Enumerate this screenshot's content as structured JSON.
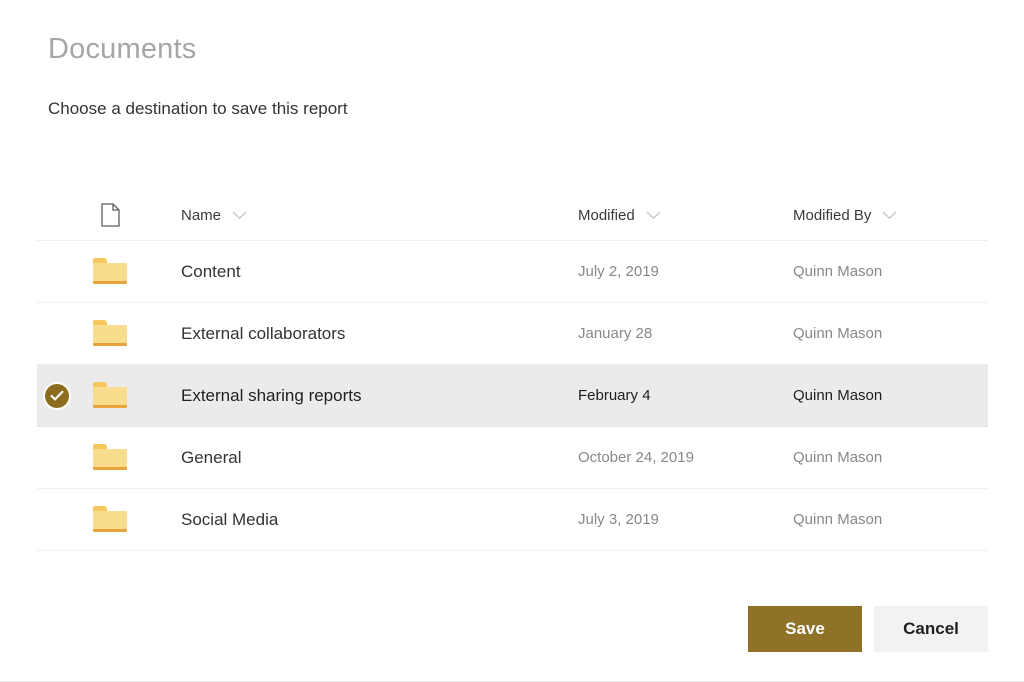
{
  "header": {
    "title": "Documents",
    "subtitle": "Choose a destination to save this report"
  },
  "table": {
    "columns": {
      "file_type_icon": "document-icon",
      "name": "Name",
      "modified": "Modified",
      "modified_by": "Modified By"
    },
    "sort_icon": "chevron-down-icon",
    "rows": [
      {
        "icon": "folder-icon",
        "name": "Content",
        "modified": "July 2, 2019",
        "modified_by": "Quinn Mason",
        "selected": false
      },
      {
        "icon": "folder-icon",
        "name": "External collaborators",
        "modified": "January 28",
        "modified_by": "Quinn Mason",
        "selected": false
      },
      {
        "icon": "folder-icon",
        "name": "External sharing reports",
        "modified": "February 4",
        "modified_by": "Quinn Mason",
        "selected": true
      },
      {
        "icon": "folder-icon",
        "name": "General",
        "modified": "October 24, 2019",
        "modified_by": "Quinn Mason",
        "selected": false
      },
      {
        "icon": "folder-icon",
        "name": "Social Media",
        "modified": "July 3, 2019",
        "modified_by": "Quinn Mason",
        "selected": false
      }
    ]
  },
  "footer": {
    "save_label": "Save",
    "cancel_label": "Cancel"
  },
  "colors": {
    "accent": "#8f7128",
    "selected_row": "#ebebeb",
    "secondary_button": "#f3f2f1",
    "folder_body": "#f9dd8e",
    "folder_lip": "#e8a33d",
    "title_text": "#a6a6a6",
    "meta_text": "#8a8886"
  }
}
